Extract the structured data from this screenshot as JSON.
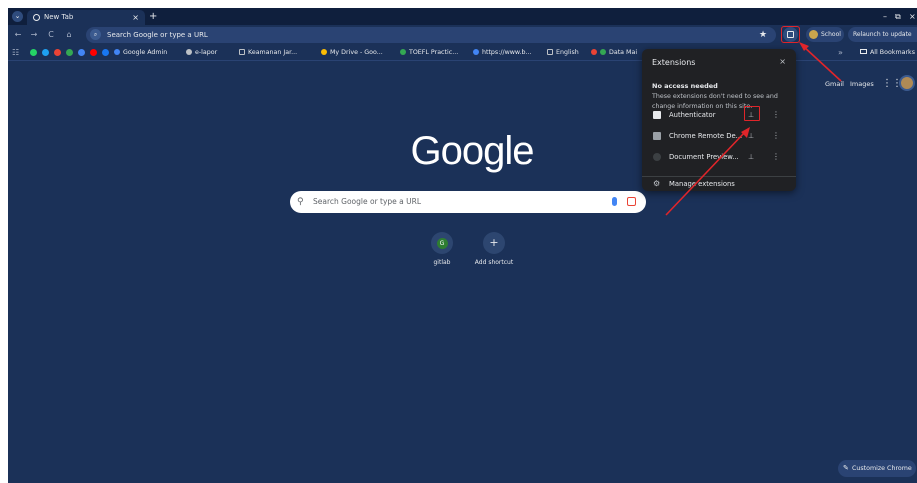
{
  "tab": {
    "title": "New Tab",
    "close": "×",
    "new_tab": "+"
  },
  "window": {
    "minimize": "–",
    "maximize": "⧉",
    "close": "×"
  },
  "toolbar": {
    "back": "←",
    "forward": "→",
    "reload": "C",
    "home": "⌂",
    "omnibox_placeholder": "Search Google or type a URL",
    "star": "★",
    "profile_label": "School",
    "relaunch_label": "Relaunch to update"
  },
  "bookmarks": {
    "items": [
      {
        "label": "Google Admin",
        "color": "#4285f4"
      },
      {
        "label": "e-lapor",
        "color": "#bdc1c6"
      },
      {
        "label": "Keamanan Jar...",
        "color": "#bdc1c6"
      },
      {
        "label": "My Drive - Goo...",
        "color": "#fbbc04"
      },
      {
        "label": "TOEFL Practic...",
        "color": "#34a853"
      },
      {
        "label": "https://www.b...",
        "color": "#4285f4"
      },
      {
        "label": "English",
        "color": "#bdc1c6"
      },
      {
        "label": "Data Mai",
        "color": "#ea4335"
      }
    ],
    "more": "»",
    "all_bookmarks": "All Bookmarks"
  },
  "page": {
    "gmail": "Gmail",
    "images": "Images",
    "logo": "Google",
    "search_placeholder": "Search Google or type a URL",
    "shortcuts": [
      {
        "label": "gitlab",
        "glyph": "G"
      },
      {
        "label": "Add shortcut",
        "glyph": "+"
      }
    ],
    "customize": "Customize Chrome"
  },
  "extensions_popup": {
    "title": "Extensions",
    "close": "×",
    "section_title": "No access needed",
    "section_desc": "These extensions don't need to see and change information on this site.",
    "items": [
      {
        "name": "Authenticator",
        "color": "#e8eaed"
      },
      {
        "name": "Chrome Remote De...",
        "color": "#9aa0a6"
      },
      {
        "name": "Document Preview...",
        "color": "#3c4043"
      }
    ],
    "pin_glyph": "⊥",
    "kebab_glyph": "⋮",
    "manage": "Manage extensions"
  },
  "colors": {
    "background": "#1b3158",
    "annotation": "#e0252a",
    "popup": "#202124"
  }
}
